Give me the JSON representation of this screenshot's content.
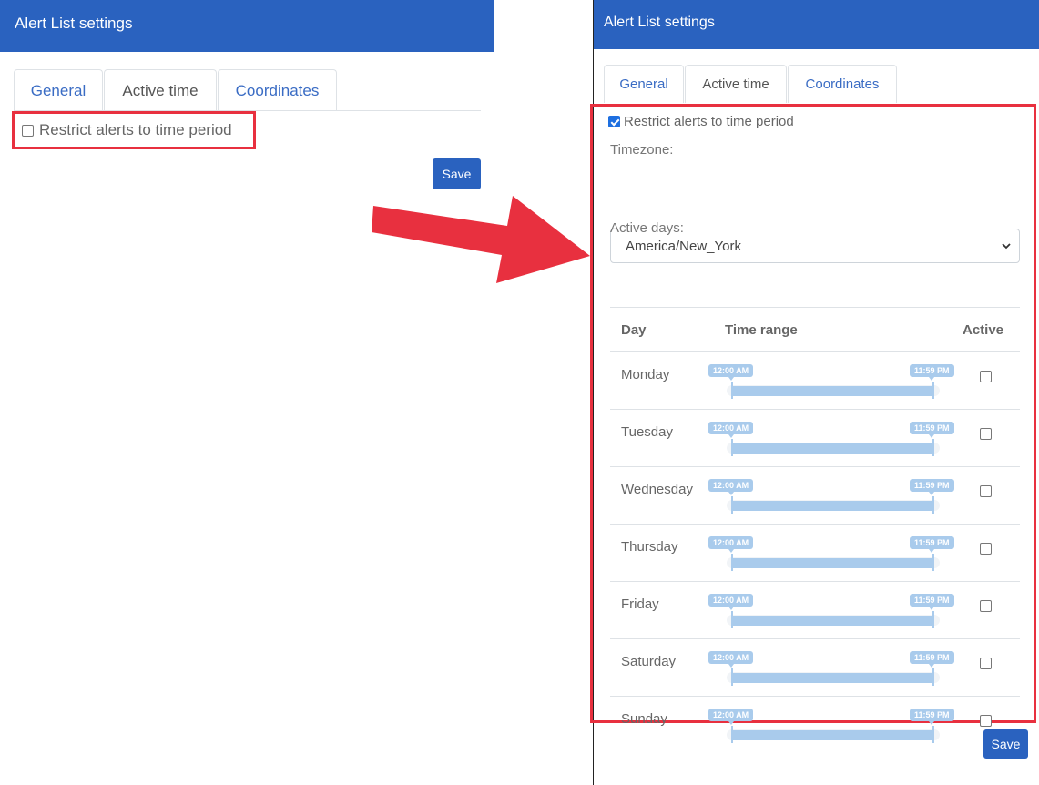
{
  "left": {
    "header": {
      "title": "Alert List settings"
    },
    "tabs": [
      {
        "label": "General",
        "active": false
      },
      {
        "label": "Active time",
        "active": true
      },
      {
        "label": "Coordinates",
        "active": false
      }
    ],
    "restrict": {
      "label": "Restrict alerts to time period",
      "checked": false
    },
    "save_label": "Save"
  },
  "right": {
    "header": {
      "title": "Alert List settings"
    },
    "tabs": [
      {
        "label": "General",
        "active": false
      },
      {
        "label": "Active time",
        "active": true
      },
      {
        "label": "Coordinates",
        "active": false
      }
    ],
    "restrict": {
      "label": "Restrict alerts to time period",
      "checked": true
    },
    "timezone_label": "Timezone:",
    "timezone_value": "America/New_York",
    "active_days_label": "Active days:",
    "table": {
      "headers": {
        "day": "Day",
        "time_range": "Time range",
        "active": "Active"
      },
      "rows": [
        {
          "day": "Monday",
          "start": "12:00 AM",
          "end": "11:59 PM",
          "active": false
        },
        {
          "day": "Tuesday",
          "start": "12:00 AM",
          "end": "11:59 PM",
          "active": false
        },
        {
          "day": "Wednesday",
          "start": "12:00 AM",
          "end": "11:59 PM",
          "active": false
        },
        {
          "day": "Thursday",
          "start": "12:00 AM",
          "end": "11:59 PM",
          "active": false
        },
        {
          "day": "Friday",
          "start": "12:00 AM",
          "end": "11:59 PM",
          "active": false
        },
        {
          "day": "Saturday",
          "start": "12:00 AM",
          "end": "11:59 PM",
          "active": false
        },
        {
          "day": "Sunday",
          "start": "12:00 AM",
          "end": "11:59 PM",
          "active": false
        }
      ]
    },
    "save_label": "Save"
  },
  "colors": {
    "header_blue": "#2a62bf",
    "highlight_red": "#e8303f",
    "slider_blue": "#a9cbec",
    "link_blue": "#3a6cc4"
  },
  "icons": {
    "arrow": "right-arrow-icon",
    "select_caret": "chevron-down-icon"
  }
}
